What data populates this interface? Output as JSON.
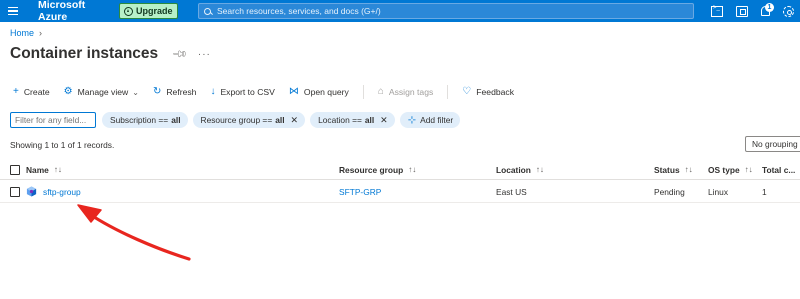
{
  "topbar": {
    "brand": "Microsoft Azure",
    "upgrade_label": "Upgrade",
    "search_placeholder": "Search resources, services, and docs (G+/)",
    "notification_count": "1"
  },
  "breadcrumb": {
    "home": "Home"
  },
  "page": {
    "title": "Container instances"
  },
  "commands": {
    "create": "Create",
    "manage_view": "Manage view",
    "refresh": "Refresh",
    "export": "Export to CSV",
    "open_query": "Open query",
    "assign_tags": "Assign tags",
    "feedback": "Feedback"
  },
  "filters": {
    "placeholder": "Filter for any field...",
    "subscription_label": "Subscription ==",
    "subscription_value": "all",
    "resource_group_label": "Resource group ==",
    "resource_group_value": "all",
    "location_label": "Location ==",
    "location_value": "all",
    "add_filter": "Add filter"
  },
  "records_text": "Showing 1 to 1 of 1 records.",
  "grouping": "No grouping",
  "table": {
    "columns": {
      "name": "Name",
      "resource_group": "Resource group",
      "location": "Location",
      "status": "Status",
      "os_type": "OS type",
      "total": "Total c..."
    },
    "rows": [
      {
        "name": "sftp-group",
        "resource_group": "SFTP-GRP",
        "location": "East US",
        "status": "Pending",
        "os_type": "Linux",
        "total": "1"
      }
    ]
  },
  "colors": {
    "azure_blue": "#0078d4",
    "arrow_red": "#e8261f",
    "upgrade_green": "#b7f0c8"
  }
}
